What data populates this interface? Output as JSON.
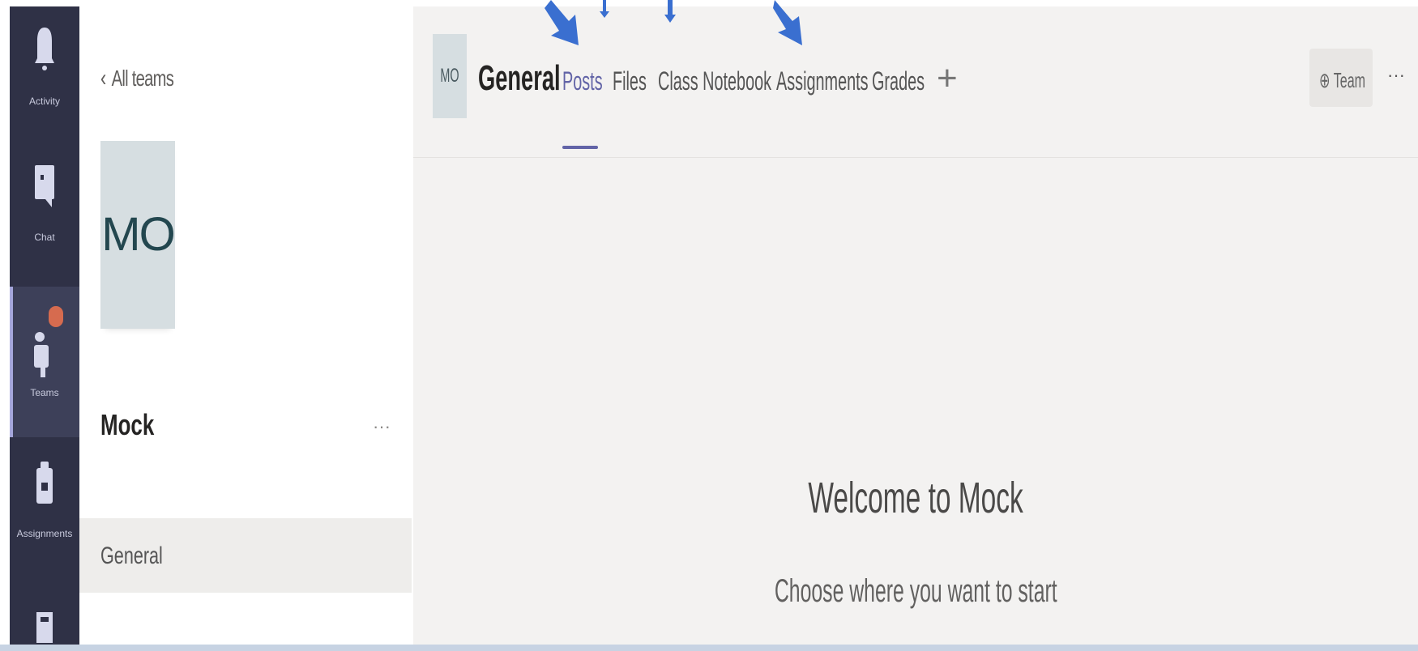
{
  "rail": {
    "items": [
      {
        "label": "Activity",
        "icon": "bell-icon"
      },
      {
        "label": "Chat",
        "icon": "chat-icon"
      },
      {
        "label": "Teams",
        "icon": "teams-icon",
        "active": true
      },
      {
        "label": "Assignments",
        "icon": "assignments-icon"
      },
      {
        "label": "",
        "icon": "calendar-icon"
      }
    ]
  },
  "team_panel": {
    "back_label": "All teams",
    "avatar_initials": "MO",
    "team_name": "Mock",
    "more_label": "···",
    "channels": [
      {
        "label": "General",
        "selected": true
      }
    ]
  },
  "header": {
    "avatar_initials": "MO",
    "channel_title": "General",
    "tabs": [
      {
        "label": "Posts",
        "active": true
      },
      {
        "label": "Files"
      },
      {
        "label": "Class Notebook"
      },
      {
        "label": "Assignments"
      },
      {
        "label": "Grades"
      }
    ],
    "add_tab_label": "+",
    "team_button_label": "⊕ Team",
    "more_label": "···"
  },
  "welcome": {
    "title": "Welcome to Mock",
    "subtitle": "Choose where you want to start"
  },
  "colors": {
    "rail_bg": "#2f3146",
    "accent": "#6264a7",
    "annotation_arrow": "#3a6fd0",
    "badge": "#d66b4f"
  }
}
